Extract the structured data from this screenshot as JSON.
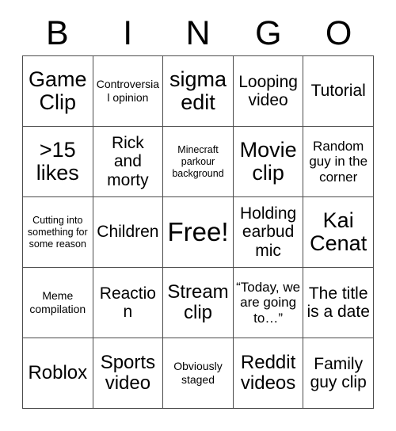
{
  "card": {
    "title": "BINGO",
    "header_letters": [
      "B",
      "I",
      "N",
      "G",
      "O"
    ],
    "columns": 5,
    "rows": 5,
    "border_color": "#4d4d4d",
    "background_color": "#ffffff",
    "text_color": "#000000"
  },
  "cells": [
    {
      "text": "Game Clip",
      "size": "xl",
      "free": false
    },
    {
      "text": "Controversial opinion",
      "size": "xs",
      "free": false
    },
    {
      "text": "sigma edit",
      "size": "xl",
      "free": false
    },
    {
      "text": "Looping video",
      "size": "md",
      "free": false
    },
    {
      "text": "Tutorial",
      "size": "md",
      "free": false
    },
    {
      "text": ">15 likes",
      "size": "xl",
      "free": false
    },
    {
      "text": "Rick and morty",
      "size": "md",
      "free": false
    },
    {
      "text": "Minecraft parkour background",
      "size": "xxs",
      "free": false
    },
    {
      "text": "Movie clip",
      "size": "xl",
      "free": false
    },
    {
      "text": "Random guy in the corner",
      "size": "sm",
      "free": false
    },
    {
      "text": "Cutting into something for some reason",
      "size": "xxs",
      "free": false
    },
    {
      "text": "Children",
      "size": "md",
      "free": false
    },
    {
      "text": "Free!",
      "size": "xxl",
      "free": true
    },
    {
      "text": "Holding earbud mic",
      "size": "md",
      "free": false
    },
    {
      "text": "Kai Cenat",
      "size": "xl",
      "free": false
    },
    {
      "text": "Meme compilation",
      "size": "xs",
      "free": false
    },
    {
      "text": "Reaction",
      "size": "md",
      "free": false
    },
    {
      "text": "Stream clip",
      "size": "lg",
      "free": false
    },
    {
      "text": "“Today, we are going to…”",
      "size": "sm",
      "free": false
    },
    {
      "text": "The title is a date",
      "size": "md",
      "free": false
    },
    {
      "text": "Roblox",
      "size": "lg",
      "free": false
    },
    {
      "text": "Sports video",
      "size": "lg",
      "free": false
    },
    {
      "text": "Obviously staged",
      "size": "xs",
      "free": false
    },
    {
      "text": "Reddit videos",
      "size": "lg",
      "free": false
    },
    {
      "text": "Family guy clip",
      "size": "md",
      "free": false
    }
  ]
}
